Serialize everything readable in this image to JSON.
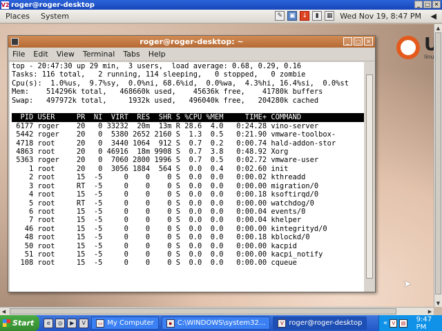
{
  "vnc": {
    "title": "roger@roger-desktop",
    "icon": "V2"
  },
  "panel": {
    "menus": [
      "Places",
      "System"
    ],
    "clock": "Wed Nov 19,  8:47 PM"
  },
  "desktop": {
    "logo_text": "U",
    "logo_sub": "linu"
  },
  "terminal": {
    "title": "roger@roger-desktop: ~",
    "menu": [
      "File",
      "Edit",
      "View",
      "Terminal",
      "Tabs",
      "Help"
    ],
    "summary": [
      "top - 20:47:30 up 29 min,  3 users,  load average: 0.68, 0.29, 0.16",
      "Tasks: 116 total,   2 running, 114 sleeping,   0 stopped,   0 zombie",
      "Cpu(s):  1.0%us,  9.7%sy,  0.0%ni, 68.6%id,  0.0%wa,  4.3%hi, 16.4%si,  0.0%st",
      "Mem:    514296k total,   468660k used,    45636k free,    41780k buffers",
      "Swap:   497972k total,     1932k used,   496040k free,   204280k cached"
    ],
    "columns": [
      "PID",
      "USER",
      "PR",
      "NI",
      "VIRT",
      "RES",
      "SHR",
      "S",
      "%CPU",
      "%MEM",
      "TIME+",
      "COMMAND"
    ],
    "processes": [
      [
        "6177",
        "roger",
        "20",
        "0",
        "33232",
        "20m",
        "13m",
        "R",
        "28.6",
        "4.0",
        "0:24.28",
        "vino-server"
      ],
      [
        "5442",
        "roger",
        "20",
        "0",
        "5380",
        "2652",
        "2160",
        "S",
        "1.3",
        "0.5",
        "0:21.90",
        "vmware-toolbox-"
      ],
      [
        "4718",
        "root",
        "20",
        "0",
        "3440",
        "1064",
        "912",
        "S",
        "0.7",
        "0.2",
        "0:00.74",
        "hald-addon-stor"
      ],
      [
        "4863",
        "root",
        "20",
        "0",
        "46916",
        "18m",
        "9908",
        "S",
        "0.7",
        "3.8",
        "0:48.92",
        "Xorg"
      ],
      [
        "5363",
        "roger",
        "20",
        "0",
        "7060",
        "2800",
        "1996",
        "S",
        "0.7",
        "0.5",
        "0:02.72",
        "vmware-user"
      ],
      [
        "1",
        "root",
        "20",
        "0",
        "3056",
        "1884",
        "564",
        "S",
        "0.0",
        "0.4",
        "0:02.60",
        "init"
      ],
      [
        "2",
        "root",
        "15",
        "-5",
        "0",
        "0",
        "0",
        "S",
        "0.0",
        "0.0",
        "0:00.02",
        "kthreadd"
      ],
      [
        "3",
        "root",
        "RT",
        "-5",
        "0",
        "0",
        "0",
        "S",
        "0.0",
        "0.0",
        "0:00.00",
        "migration/0"
      ],
      [
        "4",
        "root",
        "15",
        "-5",
        "0",
        "0",
        "0",
        "S",
        "0.0",
        "0.0",
        "0:00.18",
        "ksoftirqd/0"
      ],
      [
        "5",
        "root",
        "RT",
        "-5",
        "0",
        "0",
        "0",
        "S",
        "0.0",
        "0.0",
        "0:00.00",
        "watchdog/0"
      ],
      [
        "6",
        "root",
        "15",
        "-5",
        "0",
        "0",
        "0",
        "S",
        "0.0",
        "0.0",
        "0:00.04",
        "events/0"
      ],
      [
        "7",
        "root",
        "15",
        "-5",
        "0",
        "0",
        "0",
        "S",
        "0.0",
        "0.0",
        "0:00.04",
        "khelper"
      ],
      [
        "46",
        "root",
        "15",
        "-5",
        "0",
        "0",
        "0",
        "S",
        "0.0",
        "0.0",
        "0:00.00",
        "kintegrityd/0"
      ],
      [
        "48",
        "root",
        "15",
        "-5",
        "0",
        "0",
        "0",
        "S",
        "0.0",
        "0.0",
        "0:00.18",
        "kblockd/0"
      ],
      [
        "50",
        "root",
        "15",
        "-5",
        "0",
        "0",
        "0",
        "S",
        "0.0",
        "0.0",
        "0:00.00",
        "kacpid"
      ],
      [
        "51",
        "root",
        "15",
        "-5",
        "0",
        "0",
        "0",
        "S",
        "0.0",
        "0.0",
        "0:00.00",
        "kacpi_notify"
      ],
      [
        "108",
        "root",
        "15",
        "-5",
        "0",
        "0",
        "0",
        "S",
        "0.0",
        "0.0",
        "0:00.00",
        "cqueue"
      ]
    ]
  },
  "taskbar": {
    "start_label": "Start",
    "tasks": [
      {
        "label": "My Computer",
        "active": false
      },
      {
        "label": "C:\\WINDOWS\\system32...",
        "active": false
      },
      {
        "label": "roger@roger-desktop",
        "active": true
      }
    ],
    "clock": "9:47 PM"
  },
  "colors": {
    "terminal_title": "#b56a35",
    "taskbar": "#2257c6",
    "ubuntu_orange": "#e35a1c"
  }
}
